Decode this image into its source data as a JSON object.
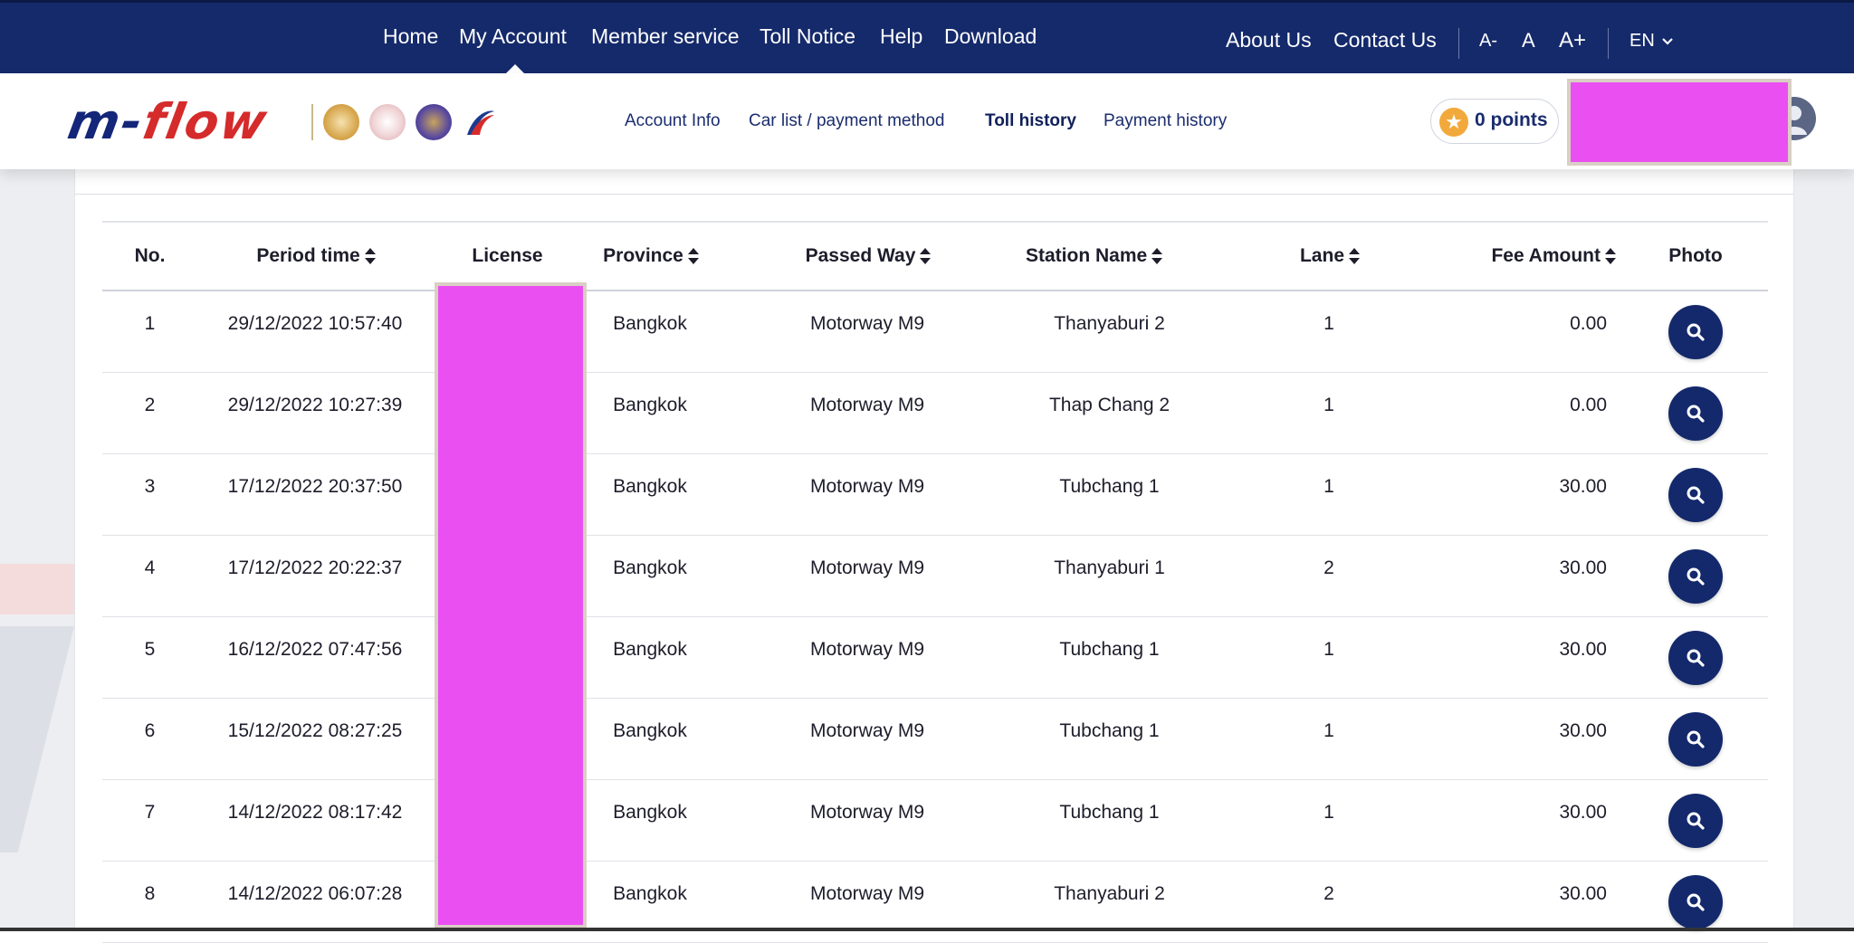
{
  "topnav": {
    "main": [
      "Home",
      "My Account",
      "Member service",
      "Toll Notice",
      "Help",
      "Download"
    ],
    "active": "My Account",
    "right": [
      "About Us",
      "Contact Us"
    ],
    "font_controls": [
      "A-",
      "A",
      "A+"
    ],
    "language": "EN"
  },
  "brand": {
    "logo_main": "m-",
    "logo_accent": "flow"
  },
  "subnav": {
    "items": [
      "Account Info",
      "Car list / payment method",
      "Toll history",
      "Payment history"
    ],
    "active": "Toll history"
  },
  "points": {
    "label": "0 points"
  },
  "table": {
    "headers": [
      "No.",
      "Period time",
      "License",
      "Province",
      "Passed Way",
      "Station Name",
      "Lane",
      "Fee Amount",
      "Photo"
    ],
    "sortable": [
      "Period time",
      "Province",
      "Passed Way",
      "Station Name",
      "Lane",
      "Fee Amount"
    ],
    "rows": [
      {
        "no": "1",
        "time": "29/12/2022 10:57:40",
        "province": "Bangkok",
        "way": "Motorway M9",
        "station": "Thanyaburi 2",
        "lane": "1",
        "fee": "0.00"
      },
      {
        "no": "2",
        "time": "29/12/2022 10:27:39",
        "province": "Bangkok",
        "way": "Motorway M9",
        "station": "Thap Chang 2",
        "lane": "1",
        "fee": "0.00"
      },
      {
        "no": "3",
        "time": "17/12/2022 20:37:50",
        "province": "Bangkok",
        "way": "Motorway M9",
        "station": "Tubchang 1",
        "lane": "1",
        "fee": "30.00"
      },
      {
        "no": "4",
        "time": "17/12/2022 20:22:37",
        "province": "Bangkok",
        "way": "Motorway M9",
        "station": "Thanyaburi 1",
        "lane": "2",
        "fee": "30.00"
      },
      {
        "no": "5",
        "time": "16/12/2022 07:47:56",
        "province": "Bangkok",
        "way": "Motorway M9",
        "station": "Tubchang 1",
        "lane": "1",
        "fee": "30.00"
      },
      {
        "no": "6",
        "time": "15/12/2022 08:27:25",
        "province": "Bangkok",
        "way": "Motorway M9",
        "station": "Tubchang 1",
        "lane": "1",
        "fee": "30.00"
      },
      {
        "no": "7",
        "time": "14/12/2022 08:17:42",
        "province": "Bangkok",
        "way": "Motorway M9",
        "station": "Tubchang 1",
        "lane": "1",
        "fee": "30.00"
      },
      {
        "no": "8",
        "time": "14/12/2022 06:07:28",
        "province": "Bangkok",
        "way": "Motorway M9",
        "station": "Thanyaburi 2",
        "lane": "2",
        "fee": "30.00"
      }
    ]
  },
  "colors": {
    "navy": "#152a6b",
    "redaction": "#ea4ff2",
    "points_star": "#f2a93b",
    "logo_red": "#d52b2b"
  },
  "icons": {
    "photo_button": "search-icon",
    "points": "star-icon",
    "language_caret": "chevron-down-icon",
    "avatar": "user-icon"
  }
}
